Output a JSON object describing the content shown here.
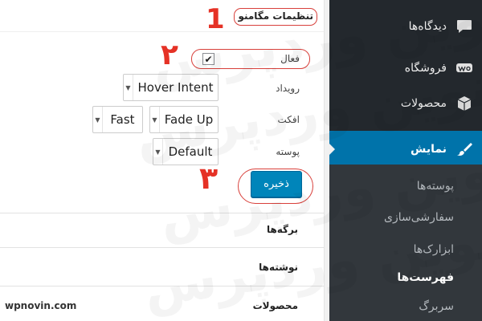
{
  "watermark": {
    "text": "نوین وردپرس"
  },
  "sidebar": {
    "items": [
      {
        "label": "دیدگاه‌ها",
        "icon": "speech-bubble-icon"
      },
      {
        "label": "فروشگاه",
        "icon": "woocommerce-icon"
      },
      {
        "label": "محصولات",
        "icon": "box-icon"
      },
      {
        "label": "نمایش",
        "icon": "paint-brush-icon"
      }
    ],
    "submenu": [
      {
        "label": "پوسته‌ها"
      },
      {
        "label": "سفارشی‌سازی"
      },
      {
        "label": "ابزارک‌ها"
      },
      {
        "label": "فهرست‌ها"
      },
      {
        "label": "سربرگ"
      }
    ]
  },
  "settings": {
    "title": "تنظیمات مگامنو",
    "active_label": "فعال",
    "active_checked": true,
    "event_label": "رویداد",
    "event_value": "Hover Intent",
    "effect_label": "افکت",
    "effect_value": "Fade Up",
    "speed_value": "Fast",
    "skin_label": "پوسته",
    "skin_value": "Default",
    "save_label": "ذخیره"
  },
  "sections": [
    {
      "label": "برگه‌ها"
    },
    {
      "label": "نوشته‌ها"
    },
    {
      "label": "محصولات"
    }
  ],
  "annotations": {
    "n1": "1",
    "n2": "۲",
    "n3": "۳"
  },
  "brand": "wpnovin.com",
  "colors": {
    "sidebar_bg": "#23282d",
    "submenu_bg": "#32373c",
    "active_bg": "#0073aa",
    "primary_button": "#0085ba",
    "annotation_red": "#e53226"
  }
}
